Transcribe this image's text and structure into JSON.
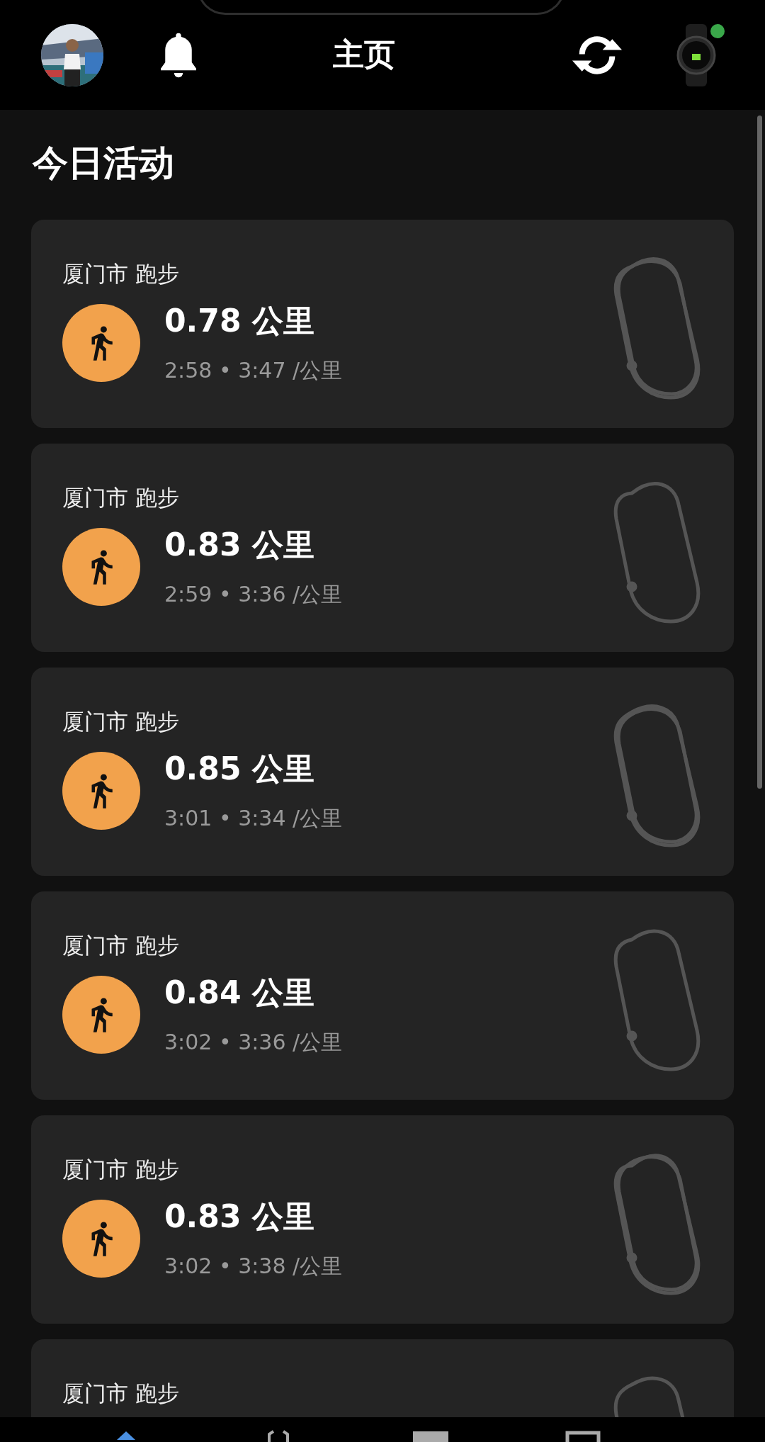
{
  "header": {
    "title": "主页"
  },
  "section": {
    "title": "今日活动"
  },
  "activities": [
    {
      "label": "厦门市 跑步",
      "distance": "0.78 公里",
      "pace": "2:58 • 3:47 /公里"
    },
    {
      "label": "厦门市 跑步",
      "distance": "0.83 公里",
      "pace": "2:59 • 3:36 /公里"
    },
    {
      "label": "厦门市 跑步",
      "distance": "0.85 公里",
      "pace": "3:01 • 3:34 /公里"
    },
    {
      "label": "厦门市 跑步",
      "distance": "0.84 公里",
      "pace": "3:02 • 3:36 /公里"
    },
    {
      "label": "厦门市 跑步",
      "distance": "0.83 公里",
      "pace": "3:02 • 3:38 /公里"
    },
    {
      "label": "厦门市 跑步"
    }
  ],
  "nav": [
    {
      "selected": true
    },
    {
      "selected": false
    },
    {
      "selected": false
    },
    {
      "selected": false
    }
  ]
}
